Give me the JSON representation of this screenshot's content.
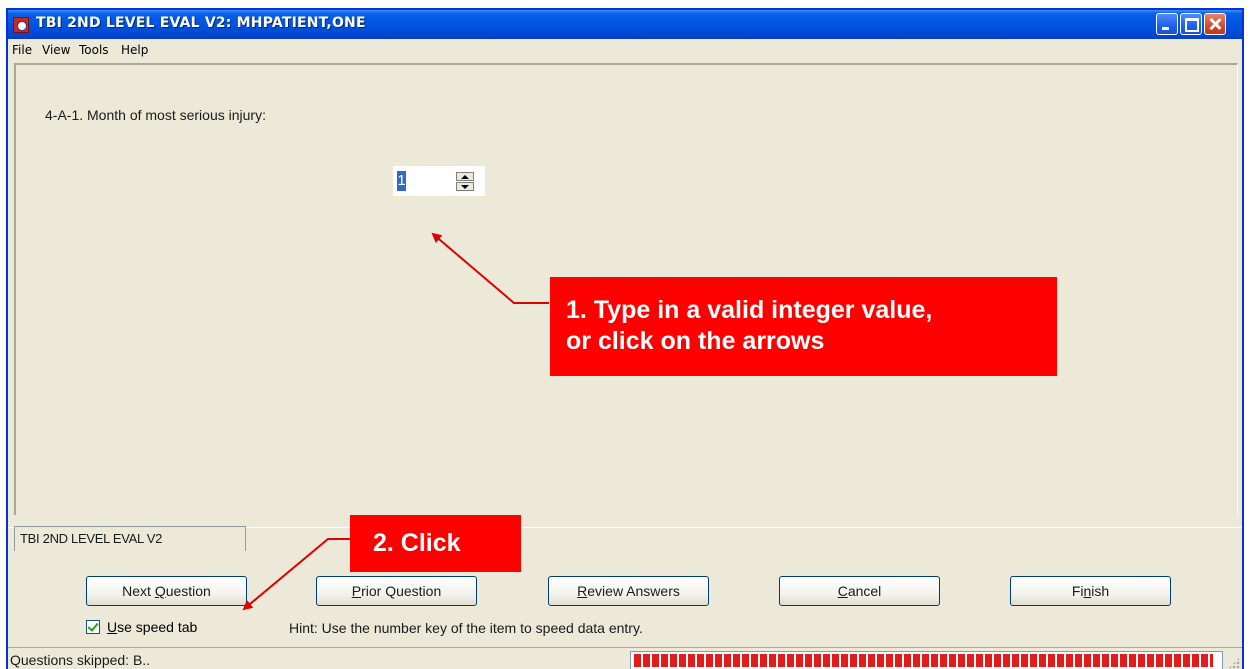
{
  "window": {
    "title": "TBI 2ND LEVEL EVAL V2: MHPATIENT,ONE",
    "controls": [
      "minimize-icon",
      "maximize-icon",
      "close-icon"
    ]
  },
  "menu": {
    "file": "File",
    "view": "View",
    "tools": "Tools",
    "help": "Help"
  },
  "question": {
    "text": "4-A-1. Month of most serious injury:",
    "value": "1"
  },
  "tab": {
    "label": "TBI 2ND LEVEL EVAL V2"
  },
  "buttons": {
    "next": "Next Question",
    "prior": "Prior Question",
    "review": "Review Answers",
    "cancel": "Cancel",
    "finish": "Finish"
  },
  "speed_tab": {
    "label": "Use speed tab",
    "checked": true
  },
  "hint": "Hint: Use the number key of the item to speed data entry.",
  "status": {
    "text": "Questions skipped: B..",
    "progress": 0.99
  },
  "callouts": {
    "step1_line1": "1. Type in a valid integer value,",
    "step1_line2": "or click on the arrows",
    "step2": "2. Click"
  },
  "colors": {
    "title_bar": "#0054e3",
    "window_bg": "#ece9d8",
    "callout": "#ff0000",
    "progress": "#e21b1b"
  }
}
